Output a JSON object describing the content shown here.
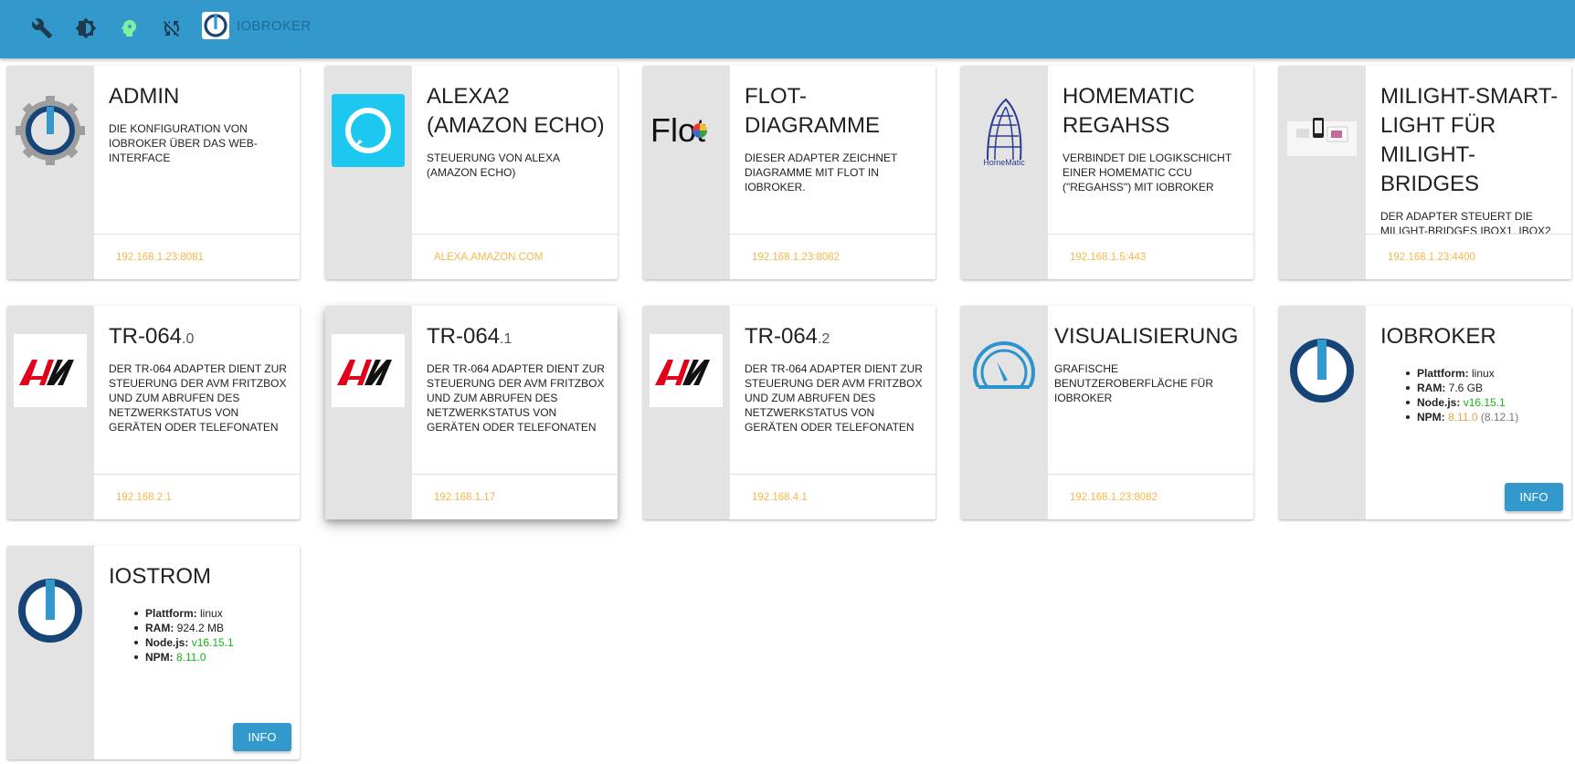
{
  "appbar": {
    "title": "IOBROKER",
    "icons": [
      "wrench-icon",
      "gear-theme-icon",
      "expert-mode-head-icon",
      "refresh-sync-icon",
      "iobroker-logo"
    ]
  },
  "colors": {
    "appbar": "#3399cc",
    "link": "#f6b64a",
    "version_green": "#13b513",
    "npm_orange": "#e6a23a"
  },
  "cards": [
    {
      "title": "ADMIN",
      "instance": "",
      "description": "DIE KONFIGURATION VON IOBROKER ÜBER DAS WEB-INTERFACE",
      "link": "192.168.1.23:8081",
      "icon": "admin-gear-icon"
    },
    {
      "title": "ALEXA2 (AMAZON ECHO)",
      "instance": "",
      "description": "STEUERUNG VON ALEXA (AMAZON ECHO)",
      "link": "ALEXA.AMAZON.COM",
      "icon": "alexa-icon"
    },
    {
      "title": "FLOT-DIAGRAMME",
      "instance": "",
      "description": "DIESER ADAPTER ZEICHNET DIAGRAMME MIT FLOT IN IOBROKER.",
      "link": "192.168.1.23:8082",
      "icon": "flot-icon",
      "logo_text": "Flot"
    },
    {
      "title": "HOMEMATIC REGAHSS",
      "instance": "",
      "description": "VERBINDET DIE LOGIKSCHICHT EINER HOMEMATIC CCU (\"REGAHSS\") MIT IOBROKER",
      "link": "192.168.1.5:443",
      "icon": "homematic-icon",
      "logo_text": "HomeMatic"
    },
    {
      "title": "MILIGHT-SMART-LIGHT FÜR MILIGHT-BRIDGES",
      "instance": "",
      "description": "DER ADAPTER STEUERT DIE MILIGHT-BRIDGES IBOX1, IBOX2",
      "link": "192.168.1.23:4400",
      "icon": "milight-icon"
    },
    {
      "title": "TR-064",
      "instance": ".0",
      "description": "DER TR-064 ADAPTER DIENT ZUR STEUERUNG DER AVM FRITZBOX UND ZUM ABRUFEN DES NETZWERKSTATUS VON GERÄTEN ODER TELEFONATEN",
      "link": "192.168.2.1",
      "icon": "avm-icon"
    },
    {
      "title": "TR-064",
      "instance": ".1",
      "description": "DER TR-064 ADAPTER DIENT ZUR STEUERUNG DER AVM FRITZBOX UND ZUM ABRUFEN DES NETZWERKSTATUS VON GERÄTEN ODER TELEFONATEN",
      "link": "192.168.1.17",
      "icon": "avm-icon"
    },
    {
      "title": "TR-064",
      "instance": ".2",
      "description": "DER TR-064 ADAPTER DIENT ZUR STEUERUNG DER AVM FRITZBOX UND ZUM ABRUFEN DES NETZWERKSTATUS VON GERÄTEN ODER TELEFONATEN",
      "link": "192.168.4.1",
      "icon": "avm-icon"
    },
    {
      "title": "VISUALISIERUNG",
      "instance": "",
      "description": "GRAFISCHE BENUTZEROBERFLÄCHE FÜR IOBROKER",
      "link": "192.168.1.23:8082",
      "icon": "vis-gauge-icon"
    }
  ],
  "hosts": [
    {
      "title": "IOBROKER",
      "platform_label": "Plattform:",
      "platform": "linux",
      "ram_label": "RAM:",
      "ram": "7.6 GB",
      "node_label": "Node.js:",
      "node": "v16.15.1",
      "npm_label": "NPM:",
      "npm": "8.11.0",
      "npm_latest": "(8.12.1)",
      "button": "INFO",
      "icon": "iobroker-host-icon"
    },
    {
      "title": "IOSTROM",
      "platform_label": "Plattform:",
      "platform": "linux",
      "ram_label": "RAM:",
      "ram": "924.2 MB",
      "node_label": "Node.js:",
      "node": "v16.15.1",
      "npm_label": "NPM:",
      "npm": "8.11.0",
      "npm_latest": "",
      "button": "INFO",
      "icon": "iobroker-host-icon"
    }
  ]
}
